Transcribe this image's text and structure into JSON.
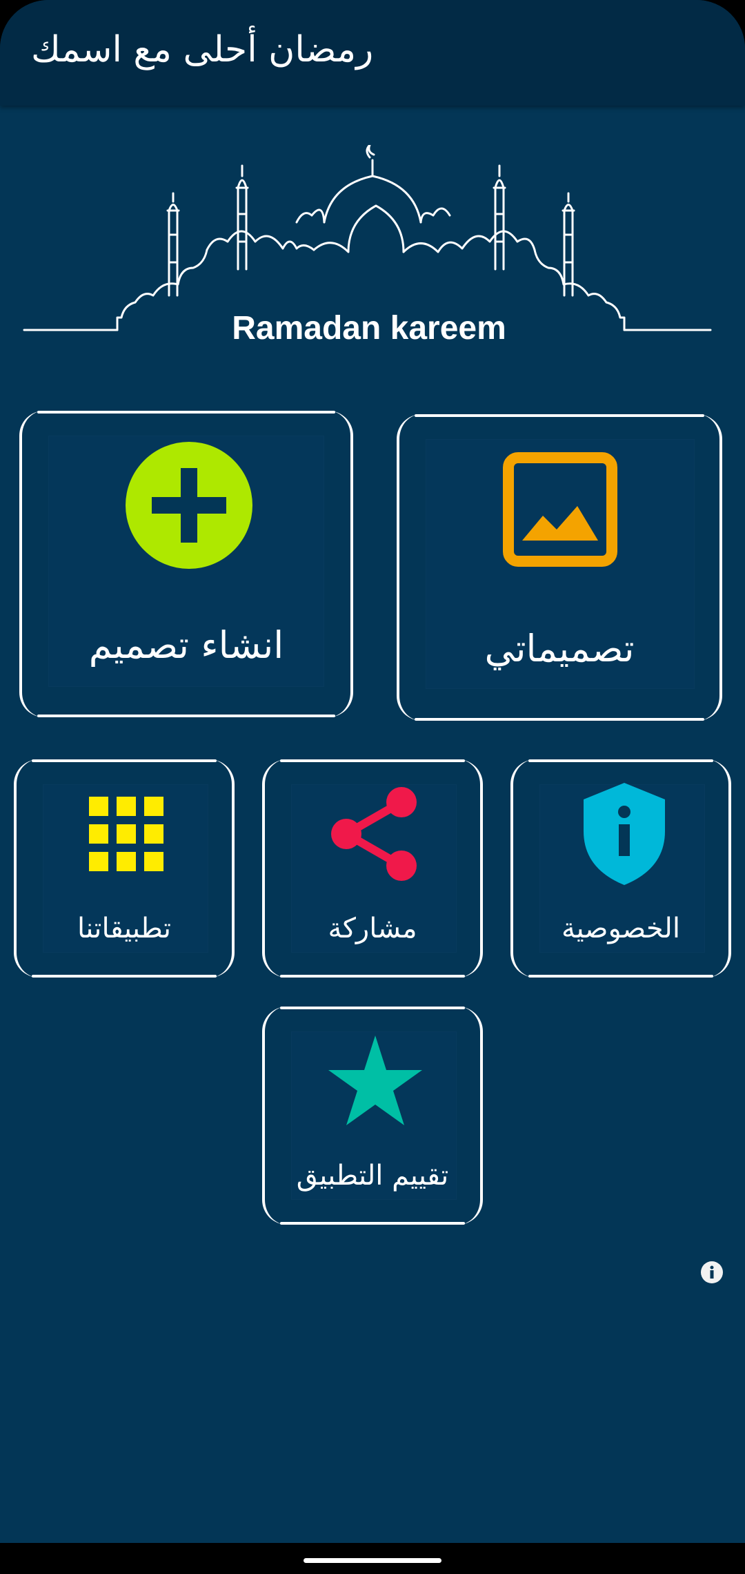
{
  "app_bar": {
    "title": "رمضان أحلى مع اسمك"
  },
  "header": {
    "greeting": "Ramadan kareem"
  },
  "tiles": {
    "create": {
      "label": "انشاء تصميم",
      "icon": "plus-circle-icon",
      "icon_color": "#aee800"
    },
    "my_designs": {
      "label": "تصميماتي",
      "icon": "image-icon",
      "icon_color": "#f4a300"
    },
    "our_apps": {
      "label": "تطبيقاتنا",
      "icon": "grid-icon",
      "icon_color": "#ffec00"
    },
    "share": {
      "label": "مشاركة",
      "icon": "share-icon",
      "icon_color": "#f0194a"
    },
    "privacy": {
      "label": "الخصوصية",
      "icon": "shield-info-icon",
      "icon_color": "#00b8d9"
    },
    "rate": {
      "label": "تقييم التطبيق",
      "icon": "star-icon",
      "icon_color": "#00bfa5"
    }
  },
  "info_button": {
    "icon": "info-icon"
  },
  "colors": {
    "background": "#033656",
    "app_bar": "#022a45",
    "text": "#ffffff"
  }
}
